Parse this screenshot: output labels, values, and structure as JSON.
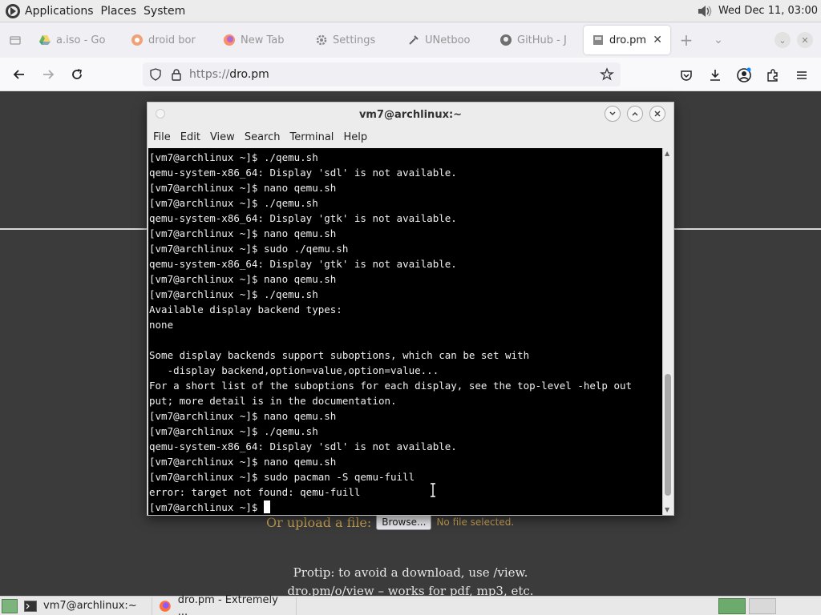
{
  "top_panel": {
    "menus": [
      "Applications",
      "Places",
      "System"
    ],
    "clock": "Wed Dec 11, 03:00"
  },
  "browser": {
    "tabs": [
      {
        "title": "a.iso - Go",
        "icon": "drive-icon",
        "active": false
      },
      {
        "title": "droid bor",
        "icon": "droid-icon",
        "active": false
      },
      {
        "title": "New Tab",
        "icon": "firefox-icon",
        "active": false
      },
      {
        "title": "Settings",
        "icon": "gear-icon",
        "active": false
      },
      {
        "title": "UNetboo",
        "icon": "tool-icon",
        "active": false
      },
      {
        "title": "GitHub - J",
        "icon": "github-icon",
        "active": false
      },
      {
        "title": "dro.pm",
        "icon": "page-icon",
        "active": true
      }
    ],
    "url_proto": "https://",
    "url_host": "dro.pm"
  },
  "page": {
    "upload_label": "Or upload a file:",
    "browse_label": "Browse...",
    "no_file_label": "No file selected.",
    "protip_line1": "Protip: to avoid a download, use /view.",
    "protip_line2": "dro.pm/o/view – works for pdf, mp3, etc."
  },
  "terminal": {
    "title": "vm7@archlinux:~",
    "menu": [
      "File",
      "Edit",
      "View",
      "Search",
      "Terminal",
      "Help"
    ],
    "lines": [
      "[vm7@archlinux ~]$ ./qemu.sh",
      "qemu-system-x86_64: Display 'sdl' is not available.",
      "[vm7@archlinux ~]$ nano qemu.sh",
      "[vm7@archlinux ~]$ ./qemu.sh",
      "qemu-system-x86_64: Display 'gtk' is not available.",
      "[vm7@archlinux ~]$ nano qemu.sh",
      "[vm7@archlinux ~]$ sudo ./qemu.sh",
      "qemu-system-x86_64: Display 'gtk' is not available.",
      "[vm7@archlinux ~]$ nano qemu.sh",
      "[vm7@archlinux ~]$ ./qemu.sh",
      "Available display backend types:",
      "none",
      "",
      "Some display backends support suboptions, which can be set with",
      "   -display backend,option=value,option=value...",
      "For a short list of the suboptions for each display, see the top-level -help out",
      "put; more detail is in the documentation.",
      "[vm7@archlinux ~]$ nano qemu.sh",
      "[vm7@archlinux ~]$ ./qemu.sh",
      "qemu-system-x86_64: Display 'sdl' is not available.",
      "[vm7@archlinux ~]$ nano qemu.sh",
      "[vm7@archlinux ~]$ sudo pacman -S qemu-fuill",
      "error: target not found: qemu-fuill",
      "[vm7@archlinux ~]$ "
    ]
  },
  "taskbar": {
    "items": [
      {
        "label": "vm7@archlinux:~",
        "icon": "terminal-icon"
      },
      {
        "label": "dro.pm - Extremely ...",
        "icon": "firefox-icon"
      }
    ]
  },
  "colors": {
    "page_bg": "#3b3b3b",
    "accent_text": "#c8a154",
    "terminal_bg": "#000000"
  }
}
